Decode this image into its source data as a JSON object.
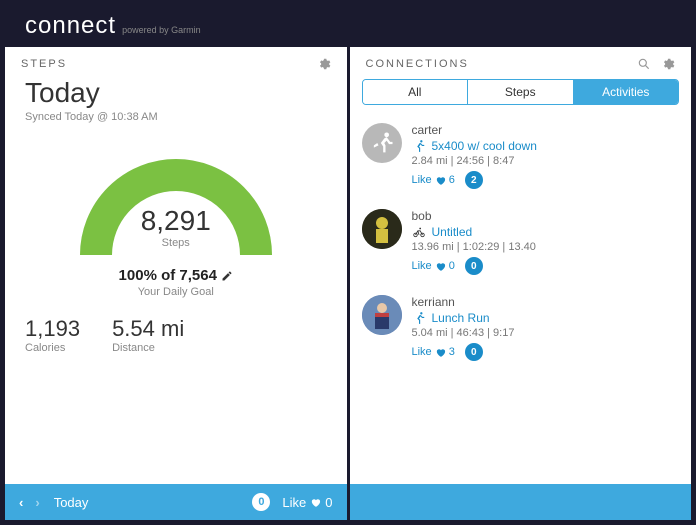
{
  "brand": {
    "logo": "connect",
    "tagline": "powered by Garmin"
  },
  "steps_panel": {
    "title": "STEPS",
    "headline": "Today",
    "synced": "Synced Today @ 10:38 AM",
    "steps_value": "8,291",
    "steps_label": "Steps",
    "goal_line": "100% of 7,564",
    "goal_sub": "Your Daily Goal",
    "calories": {
      "value": "1,193",
      "label": "Calories"
    },
    "distance": {
      "value": "5.54 mi",
      "label": "Distance"
    },
    "footer": {
      "period": "Today",
      "comments": "0",
      "like_label": "Like",
      "likes": "0"
    }
  },
  "connections_panel": {
    "title": "CONNECTIONS",
    "tabs": {
      "all": "All",
      "steps": "Steps",
      "activities": "Activities"
    },
    "feed": [
      {
        "user": "carter",
        "activity": "5x400 w/ cool down",
        "meta": "2.84 mi | 24:56 | 8:47",
        "likes": "6",
        "comments": "2",
        "type": "run"
      },
      {
        "user": "bob",
        "activity": "Untitled",
        "meta": "13.96 mi | 1:02:29 | 13.40",
        "likes": "0",
        "comments": "0",
        "type": "bike"
      },
      {
        "user": "kerriann",
        "activity": "Lunch Run",
        "meta": "5.04 mi | 46:43 | 9:17",
        "likes": "3",
        "comments": "0",
        "type": "run"
      }
    ],
    "like_label": "Like"
  },
  "colors": {
    "accent": "#3ea9de",
    "gauge": "#7bc142"
  }
}
